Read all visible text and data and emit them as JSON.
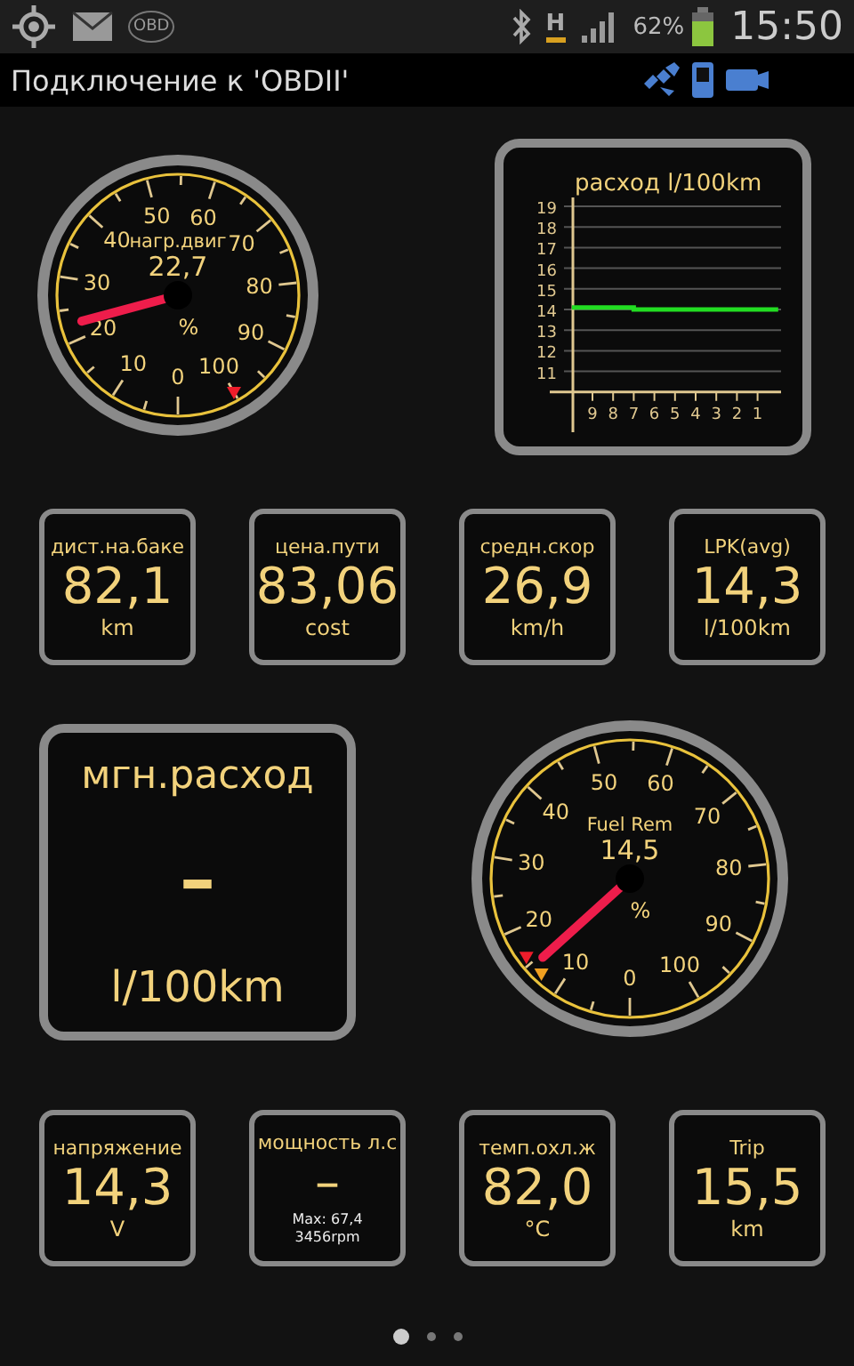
{
  "status_bar": {
    "obd_badge": "OBD",
    "network_type": "H",
    "battery_text": "62%",
    "time": "15:50"
  },
  "title_bar": {
    "title": "Подключение к 'OBDII'"
  },
  "engine_load_gauge": {
    "label": "нагр.двиг",
    "value": "22,7",
    "unit": "%",
    "scale": [
      "0",
      "10",
      "20",
      "30",
      "40",
      "50",
      "60",
      "70",
      "80",
      "90",
      "100"
    ]
  },
  "consumption_chart": {
    "chart_data": {
      "type": "line",
      "title": "расход l/100km",
      "x": [
        10,
        9,
        8,
        7,
        6,
        5,
        4,
        3,
        2,
        1,
        0
      ],
      "xlim": [
        10,
        0
      ],
      "grid": true,
      "xticks": [
        9,
        8,
        7,
        6,
        5,
        4,
        3,
        2,
        1
      ],
      "yticks": [
        11,
        12,
        13,
        14,
        15,
        16,
        17,
        18,
        19
      ],
      "ylim": [
        10,
        19
      ],
      "series": [
        {
          "color": "#22dd22",
          "values": [
            14.1,
            14.1,
            14.1,
            14,
            14,
            14,
            14,
            14,
            14,
            14,
            14
          ]
        }
      ]
    }
  },
  "tiles_row_1": [
    {
      "label": "дист.на.баке",
      "value": "82,1",
      "unit": "km"
    },
    {
      "label": "цена.пути",
      "value": "83,06",
      "unit": "cost"
    },
    {
      "label": "средн.скор",
      "value": "26,9",
      "unit": "km/h"
    },
    {
      "label": "LPK(avg)",
      "value": "14,3",
      "unit": "l/100km"
    }
  ],
  "instant_consumption": {
    "label": "мгн.расход",
    "value": "–",
    "unit": "l/100km"
  },
  "fuel_gauge": {
    "label": "Fuel Rem",
    "value": "14,5",
    "unit": "%",
    "scale": [
      "0",
      "10",
      "20",
      "30",
      "40",
      "50",
      "60",
      "70",
      "80",
      "90",
      "100"
    ]
  },
  "tiles_row_2": [
    {
      "label": "напряжение",
      "value": "14,3",
      "unit": "V"
    },
    {
      "label": "мощность л.с",
      "value": "–",
      "notes": [
        "Max: 67,4",
        "3456rpm"
      ]
    },
    {
      "label": "темп.охл.ж",
      "value": "82,0",
      "unit": "°C"
    },
    {
      "label": "Trip",
      "value": "15,5",
      "unit": "km"
    }
  ],
  "page_dots": [
    {
      "selected": true
    },
    {
      "selected": false
    },
    {
      "selected": false
    }
  ]
}
